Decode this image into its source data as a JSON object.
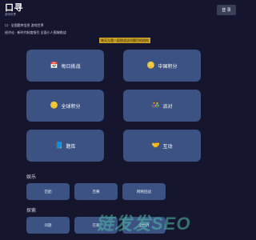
{
  "header": {
    "logo_text": "口寻",
    "logo_sub": "游戏世界",
    "login_label": "登 录"
  },
  "info": {
    "line1": "口 · 全国题库信息 游戏世界",
    "line2": "经济论 · 新时代制度指引 全面小人围城挑战"
  },
  "banner": "每天与我一起挑战这份题目的结构",
  "cards": [
    {
      "icon": "📅",
      "label": "每日挑战"
    },
    {
      "icon": "🪙",
      "label": "中国积分"
    },
    {
      "icon": "🪙",
      "label": "全球积分"
    },
    {
      "icon": "👫",
      "label": "派对"
    },
    {
      "icon": "📘",
      "label": "题库"
    },
    {
      "icon": "🤝",
      "label": "互动"
    }
  ],
  "sections": [
    {
      "title": "娱乐",
      "items": [
        "匹配",
        "百赛",
        "网络团战"
      ]
    },
    {
      "title": "探索",
      "items": [
        "问题",
        "在家",
        "全世界"
      ]
    }
  ],
  "colors": {
    "background": "#15152e",
    "card": "#3b5283",
    "banner": "#caa126"
  },
  "watermark": "链发发SEO"
}
